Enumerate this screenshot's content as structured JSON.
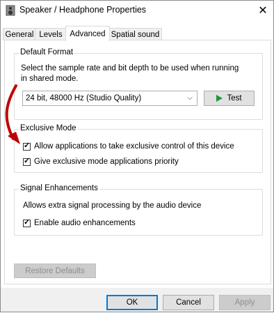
{
  "window": {
    "title": "Speaker / Headphone Properties",
    "close_label": "✕",
    "title_icon": "speaker-icon"
  },
  "tabs": [
    {
      "label": "General",
      "active": false
    },
    {
      "label": "Levels",
      "active": false
    },
    {
      "label": "Advanced",
      "active": true
    },
    {
      "label": "Spatial sound",
      "active": false
    }
  ],
  "default_format": {
    "title": "Default Format",
    "description_line1": "Select the sample rate and bit depth to be used when running",
    "description_line2": "in shared mode.",
    "selected_value": "24 bit, 48000 Hz (Studio Quality)",
    "test_label": "Test",
    "test_icon": "play-icon"
  },
  "exclusive_mode": {
    "title": "Exclusive Mode",
    "options": [
      {
        "label": "Allow applications to take exclusive control of this device",
        "checked": true
      },
      {
        "label": "Give exclusive mode applications priority",
        "checked": true
      }
    ]
  },
  "signal_enhancements": {
    "title": "Signal Enhancements",
    "description": "Allows extra signal processing by the audio device",
    "option": {
      "label": "Enable audio enhancements",
      "checked": true
    }
  },
  "restore_defaults_label": "Restore Defaults",
  "buttons": {
    "ok": "OK",
    "cancel": "Cancel",
    "apply": "Apply"
  },
  "colors": {
    "annotation_arrow": "#c00000",
    "test_icon": "#1a9a3b",
    "focus_border": "#0078d7"
  }
}
